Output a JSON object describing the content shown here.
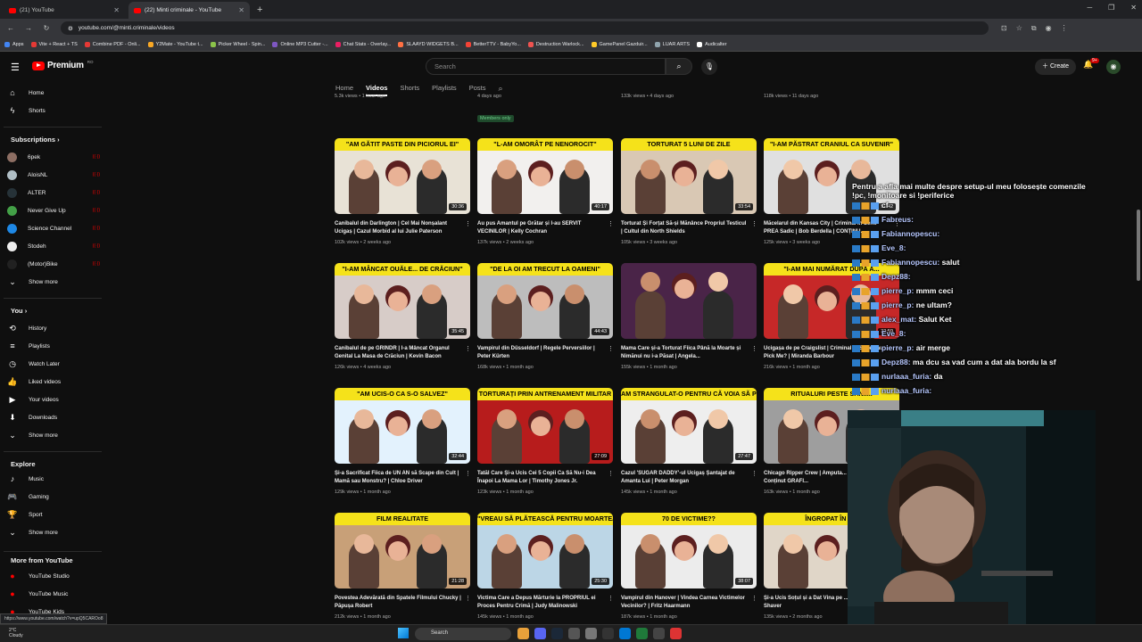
{
  "browser": {
    "tabs": [
      {
        "title": "(21) YouTube",
        "active": false
      },
      {
        "title": "(22) Minti criminale - YouTube",
        "active": true
      }
    ],
    "url": "youtube.com/@minti.criminale/videos",
    "bookmarks": [
      "Apps",
      "Vite + React + TS",
      "Combine PDF - Onli...",
      "Y2Mate - YouTube t...",
      "Picker Wheel - Spin...",
      "Online MP3 Cutter -...",
      "Chat Stats - Overlay...",
      "SLAAYD WIDGETS B...",
      "BetterTTV - BabyYo...",
      "Destruction Warlock...",
      "GamePanel Gazduir...",
      "LUAR ARTS",
      "Audicalter"
    ],
    "status_url": "https://www.youtube.com/watch?v=upQ5CAROo8"
  },
  "header": {
    "brand": "Premium",
    "brand_sup": "RO",
    "search_placeholder": "Search",
    "create_label": "Create",
    "notif_count": "9+"
  },
  "sidebar": {
    "home": "Home",
    "shorts": "Shorts",
    "subscriptions_title": "Subscriptions",
    "subscriptions": [
      {
        "name": "6pek",
        "color": "#8d6e63"
      },
      {
        "name": "AloisNL",
        "color": "#b0bec5"
      },
      {
        "name": "ALTER",
        "color": "#263238"
      },
      {
        "name": "Never Give Up",
        "color": "#43a047"
      },
      {
        "name": "Science Channel",
        "color": "#1e88e5"
      },
      {
        "name": "Stodeh",
        "color": "#eeeeee"
      },
      {
        "name": "(Motor)Bike",
        "color": "#212121"
      }
    ],
    "show_more": "Show more",
    "you_title": "You",
    "you_items": [
      "History",
      "Playlists",
      "Watch Later",
      "Liked videos",
      "Your videos",
      "Downloads",
      "Show more"
    ],
    "explore_title": "Explore",
    "explore_items": [
      "Music",
      "Gaming",
      "Sport",
      "Show more"
    ],
    "more_title": "More from YouTube",
    "more_items": [
      "YouTube Studio",
      "YouTube Music",
      "YouTube Kids"
    ]
  },
  "channel_tabs": [
    "Home",
    "Videos",
    "Shorts",
    "Playlists",
    "Posts"
  ],
  "row0": [
    {
      "meta": "5.3k views • 1 hour ago"
    },
    {
      "meta": "4 days ago",
      "badge": "Members only"
    },
    {
      "meta": "133k views • 4 days ago"
    },
    {
      "meta": "118k views • 11 days ago"
    }
  ],
  "videos": [
    {
      "headline": "\"AM GĂTIT PASTE DIN PICIORUL EI\"",
      "title": "Canibalul din Darlington | Cel Mai Nonșalant Ucigaș | Cazul Morbid al lui Julie Paterson",
      "meta": "102k views • 2 weeks ago",
      "duration": "30:36",
      "bg": "#e8e2d6"
    },
    {
      "headline": "\"L-AM OMORÂT PE NENOROCIT\"",
      "title": "Au pus Amantul pe Grătar și l-au SERVIT VECINILOR | Kelly Cochran",
      "meta": "137k views • 2 weeks ago",
      "duration": "40:17",
      "bg": "#f2f0ee"
    },
    {
      "headline": "TORTURAT 5 LUNI DE ZILE",
      "title": "Torturat Și Forțat Să-și Mănânce Propriul Testicul | Cultul din North Shields",
      "meta": "105k views • 3 weeks ago",
      "duration": "33:54",
      "bg": "#d9c8b4"
    },
    {
      "headline": "\"I-AM PĂSTRAT CRANIUL CA SUVENIR\"",
      "title": "Măcelarul din Kansas City | Criminal în Serie PREA Sadic | Bob Berdella | CONȚINU...",
      "meta": "125k views • 3 weeks ago",
      "duration": "51:42",
      "bg": "#e0e0e0"
    },
    {
      "headline": "\"I-AM MÂNCAT OUĂLE... DE CRĂCIUN\"",
      "title": "Canibalul de pe GRINDR | I-a Mâncat Organul Genital La Masa de Crăciun | Kevin Bacon",
      "meta": "126k views • 4 weeks ago",
      "duration": "35:45",
      "bg": "#d7ccc8"
    },
    {
      "headline": "\"DE LA OI AM TRECUT LA OAMENI\"",
      "title": "Vampirul din Düsseldorf | Regele Perversiilor | Peter Kürten",
      "meta": "168k views • 1 month ago",
      "duration": "44:43",
      "bg": "#bdbdbd"
    },
    {
      "headline": "",
      "title": "Mama Care și-a Torturat Fiica Până la Moarte și Nimănui nu i-a Păsat | Angela...",
      "meta": "155k views • 1 month ago",
      "duration": "",
      "bg": "#4a2448"
    },
    {
      "headline": "\"I-AM MAI NUMĂRAT DUPĂ A...",
      "title": "Ucigașa de pe Craigslist | Criminal în Serie sau Pick Me? | Miranda Barbour",
      "meta": "216k views • 1 month ago",
      "duration": "32:59",
      "bg": "#c62828"
    },
    {
      "headline": "\"AM UCIS-O CA S-O SALVEZ\"",
      "title": "Și-a Sacrificat Fiica de UN AN să Scape din Cult | Mamă sau Monstru? | Chloe Driver",
      "meta": "129k views • 1 month ago",
      "duration": "32:44",
      "bg": "#e3f2fd"
    },
    {
      "headline": "TORTURAȚI PRIN ANTRENAMENT MILITAR",
      "title": "Tatăl Care Și-a Ucis Cei 5 Copii Ca Să Nu-i Dea Înapoi La Mama Lor | Timothy Jones Jr.",
      "meta": "123k views • 1 month ago",
      "duration": "27:09",
      "bg": "#b71c1c"
    },
    {
      "headline": "AM STRANGULAT-O PENTRU CĂ VOIA SĂ PLECE",
      "title": "Cazul 'SUGAR DADDY'-ul Ucigaș Șantajat de Amanta Lui | Peter Morgan",
      "meta": "145k views • 1 month ago",
      "duration": "27:47",
      "bg": "#eeeeee"
    },
    {
      "headline": "RITUALURI PESTE SĂNII...",
      "title": "Chicago Ripper Crew | Amputa... Victimelor ?? | Conținut GRAFI...",
      "meta": "163k views • 1 month ago",
      "duration": "",
      "bg": "#9e9e9e"
    },
    {
      "headline": "FILM   REALITATE",
      "title": "Povestea Adevărată din Spatele Filmului Chucky | Păpușa Robert",
      "meta": "212k views • 1 month ago",
      "duration": "21:28",
      "bg": "#c8a078"
    },
    {
      "headline": "\"VREAU SĂ PLĂTEASCĂ PENTRU MOARTEA MEA\"",
      "title": "Victima Care a Depus Mărturie la PROPRIUL ei Proces Pentru Crimă | Judy Malinowski",
      "meta": "145k views • 1 month ago",
      "duration": "25:30",
      "bg": "#bcd6e6"
    },
    {
      "headline": "70 DE VICTIME??",
      "title": "Vampirul din Hanover | Vindea Carnea Victimelor Vecinilor? | Fritz Haarmann",
      "meta": "187k views • 1 month ago",
      "duration": "38:07",
      "bg": "#ececec"
    },
    {
      "headline": "ÎNGROPAT ÎN B...",
      "title": "Și-a Ucis Soțul și a Dat Vina pe ... ANI ?? | Laurie Shaver",
      "meta": "135k views • 2 months ago",
      "duration": "",
      "bg": "#e0d6c8"
    }
  ],
  "chat": [
    {
      "user": "",
      "text": "Pentru a afla mai multe despre setup-ul meu folosește comenzile !pc, !monitoare si !periferice"
    },
    {
      "user": "",
      "text": "cf"
    },
    {
      "user": "Fabreus:",
      "text": ""
    },
    {
      "user": "Fabiannopescu:",
      "text": ""
    },
    {
      "user": "Eve_8:",
      "text": ""
    },
    {
      "user": "Fabiannopescu:",
      "text": "salut"
    },
    {
      "user": "Depz88:",
      "text": ""
    },
    {
      "user": "pierre_p:",
      "text": "mmm ceci"
    },
    {
      "user": "pierre_p:",
      "text": "ne ultam?"
    },
    {
      "user": "alex_mat:",
      "text": "Salut Ket"
    },
    {
      "user": "Eve_8:",
      "text": ""
    },
    {
      "user": "pierre_p:",
      "text": "air merge"
    },
    {
      "user": "Depz88:",
      "text": "ma dcu sa vad cum a dat ala bordu la sf"
    },
    {
      "user": "nurlaaa_furia:",
      "text": "da"
    },
    {
      "user": "nurlaaa_furia:",
      "text": ""
    }
  ],
  "taskbar": {
    "temp": "2°C",
    "weather": "Cloudy",
    "search": "Search"
  }
}
